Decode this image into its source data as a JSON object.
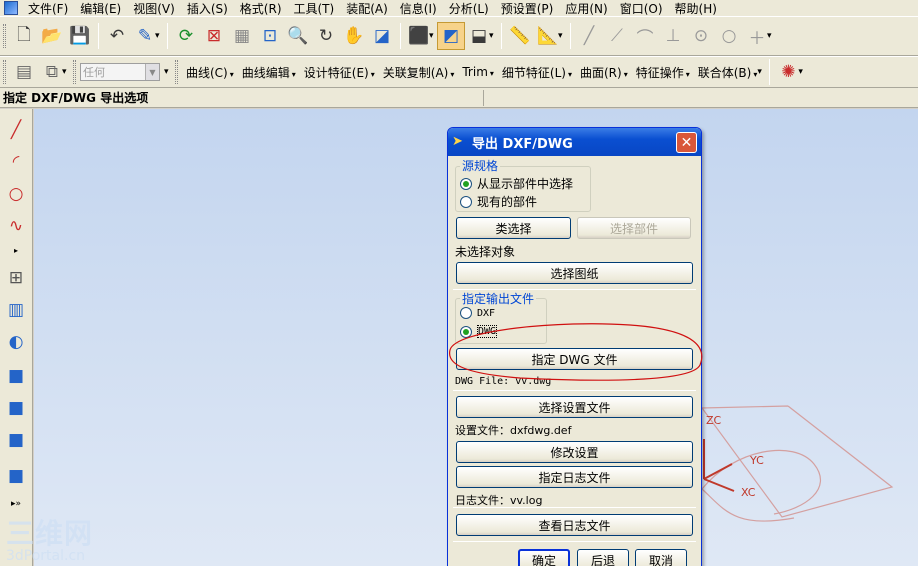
{
  "menubar": {
    "items": [
      "文件(F)",
      "编辑(E)",
      "视图(V)",
      "插入(S)",
      "格式(R)",
      "工具(T)",
      "装配(A)",
      "信息(I)",
      "分析(L)",
      "预设置(P)",
      "应用(N)",
      "窗口(O)",
      "帮助(H)"
    ]
  },
  "toolbar2": {
    "filter_value": "任何",
    "menus": [
      "曲线(C)",
      "曲线编辑",
      "设计特征(E)",
      "关联复制(A)",
      "Trim",
      "细节特征(L)",
      "曲面(R)",
      "特征操作",
      "联合体(B)"
    ]
  },
  "cue_line": "指定 DXF/DWG 导出选项",
  "dialog": {
    "title": "导出 DXF/DWG",
    "source_group": "源规格",
    "source_opt1": "从显示部件中选择",
    "source_opt2": "现有的部件",
    "class_select_btn": "类选择",
    "select_part_btn": "选择部件",
    "no_selection_text": "未选择对象",
    "select_drawing_btn": "选择图纸",
    "output_group": "指定输出文件",
    "opt_dxf": "DXF",
    "opt_dwg": "DWG",
    "specify_dwg_btn": "指定 DWG 文件",
    "dwg_file_text": "DWG File: vv.dwg",
    "select_settings_btn": "选择设置文件",
    "settings_file_text": "设置文件：dxfdwg.def",
    "modify_settings_btn": "修改设置",
    "specify_log_btn": "指定日志文件",
    "log_file_text": "日志文件：vv.log",
    "view_log_btn": "查看日志文件",
    "ok_btn": "确定",
    "back_btn": "后退",
    "cancel_btn": "取消"
  },
  "graphics": {
    "axis_labels": [
      "ZC",
      "YC",
      "XC"
    ]
  },
  "watermark": {
    "big": "三维网",
    "small": "3dPortal.cn"
  },
  "colors": {
    "dialog_title": "#0a4fd1",
    "annotation_red": "#d01010",
    "graphics_bg": "#c3d5ef"
  }
}
